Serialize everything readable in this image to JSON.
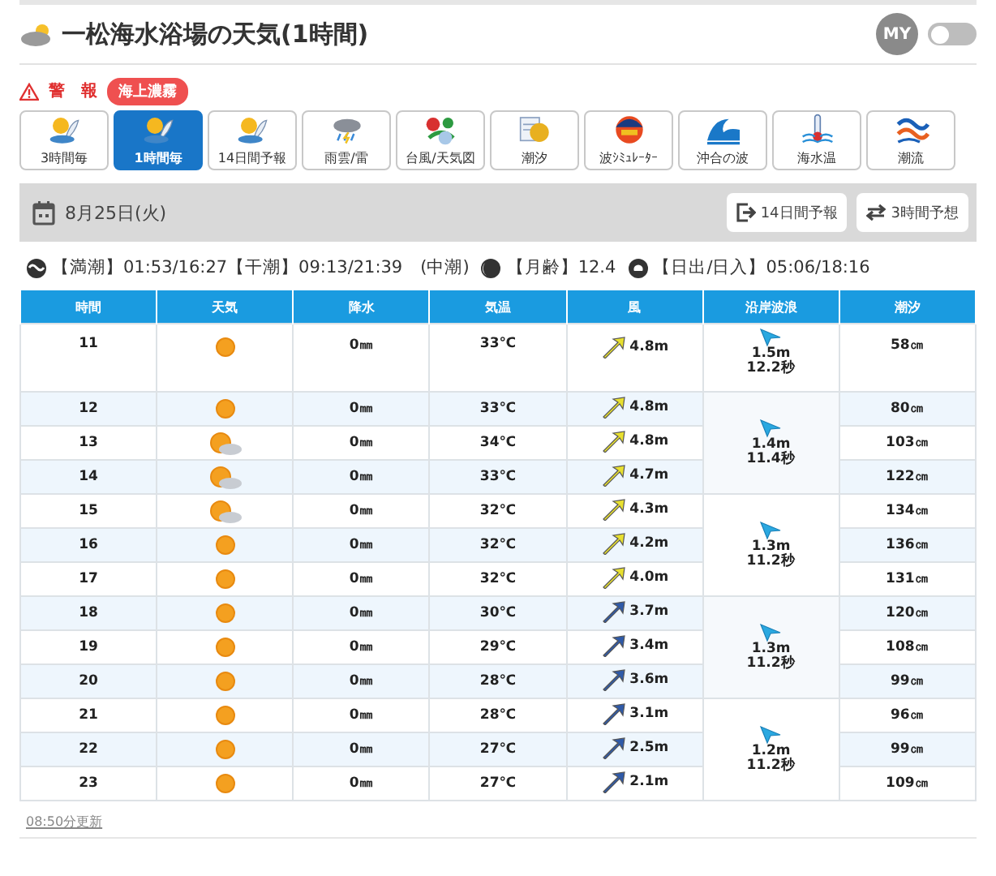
{
  "header": {
    "title": "一松海水浴場の天気(1時間)",
    "my_badge": "MY",
    "my_toggle_on": false
  },
  "warning": {
    "label": "警　報",
    "tags": [
      "海上濃霧"
    ]
  },
  "nav": [
    {
      "label": "3時間毎",
      "kind": "umbrella",
      "selected": false
    },
    {
      "label": "1時間毎",
      "kind": "umbrella",
      "selected": true
    },
    {
      "label": "14日間予報",
      "kind": "umbrella",
      "selected": false
    },
    {
      "label": "雨雲/雷",
      "kind": "rain",
      "selected": false
    },
    {
      "label": "台風/天気図",
      "kind": "map",
      "selected": false
    },
    {
      "label": "潮汐",
      "kind": "calendar",
      "selected": false
    },
    {
      "label": "波ｼﾐｭﾚｰﾀｰ",
      "kind": "face",
      "selected": false
    },
    {
      "label": "沖合の波",
      "kind": "wave",
      "selected": false
    },
    {
      "label": "海水温",
      "kind": "thermometer",
      "selected": false
    },
    {
      "label": "潮流",
      "kind": "current",
      "selected": false
    }
  ],
  "date_bar": {
    "date": "8月25日(火)",
    "buttons": [
      {
        "label": "14日間予報",
        "kind": "exit"
      },
      {
        "label": "3時間予想",
        "kind": "swap"
      }
    ]
  },
  "tide_info": [
    {
      "kind": "tide",
      "text": "【満潮】01:53/16:27【干潮】09:13/21:39　(中潮)"
    },
    {
      "kind": "moon",
      "text": "【月齢】12.4"
    },
    {
      "kind": "sunrise",
      "text": "【日出/日入】05:06/18:16"
    }
  ],
  "table": {
    "columns": [
      "時間",
      "天気",
      "降水",
      "気温",
      "風",
      "沿岸波浪",
      "潮汐"
    ],
    "groups": [
      {
        "wave": {
          "height": "1.5m",
          "period": "12.2秒"
        },
        "rows": [
          {
            "hour": "11",
            "kind": "sunny",
            "precip": "0㎜",
            "temp": "33℃",
            "wind": {
              "speed": "4.8m",
              "color": "#e8e030"
            },
            "tide": "58㎝"
          }
        ]
      },
      {
        "wave": {
          "height": "1.4m",
          "period": "11.4秒"
        },
        "rows": [
          {
            "hour": "12",
            "kind": "sunny",
            "precip": "0㎜",
            "temp": "33℃",
            "wind": {
              "speed": "4.8m",
              "color": "#e8e030"
            },
            "tide": "80㎝"
          },
          {
            "hour": "13",
            "kind": "partly_cloudy",
            "precip": "0㎜",
            "temp": "34℃",
            "wind": {
              "speed": "4.8m",
              "color": "#e8e030"
            },
            "tide": "103㎝"
          },
          {
            "hour": "14",
            "kind": "partly_cloudy",
            "precip": "0㎜",
            "temp": "33℃",
            "wind": {
              "speed": "4.7m",
              "color": "#e8e030"
            },
            "tide": "122㎝"
          }
        ]
      },
      {
        "wave": {
          "height": "1.3m",
          "period": "11.2秒"
        },
        "rows": [
          {
            "hour": "15",
            "kind": "partly_cloudy",
            "precip": "0㎜",
            "temp": "32℃",
            "wind": {
              "speed": "4.3m",
              "color": "#e8e030"
            },
            "tide": "134㎝"
          },
          {
            "hour": "16",
            "kind": "sunny",
            "precip": "0㎜",
            "temp": "32℃",
            "wind": {
              "speed": "4.2m",
              "color": "#e8e030"
            },
            "tide": "136㎝"
          },
          {
            "hour": "17",
            "kind": "sunny",
            "precip": "0㎜",
            "temp": "32℃",
            "wind": {
              "speed": "4.0m",
              "color": "#e8e030"
            },
            "tide": "131㎝"
          }
        ]
      },
      {
        "wave": {
          "height": "1.3m",
          "period": "11.2秒"
        },
        "rows": [
          {
            "hour": "18",
            "kind": "sunny",
            "precip": "0㎜",
            "temp": "30℃",
            "wind": {
              "speed": "3.7m",
              "color": "#2f5aa8"
            },
            "tide": "120㎝"
          },
          {
            "hour": "19",
            "kind": "sunny",
            "precip": "0㎜",
            "temp": "29℃",
            "wind": {
              "speed": "3.4m",
              "color": "#2f5aa8"
            },
            "tide": "108㎝"
          },
          {
            "hour": "20",
            "kind": "sunny",
            "precip": "0㎜",
            "temp": "28℃",
            "wind": {
              "speed": "3.6m",
              "color": "#2f5aa8"
            },
            "tide": "99㎝"
          }
        ]
      },
      {
        "wave": {
          "height": "1.2m",
          "period": "11.2秒"
        },
        "rows": [
          {
            "hour": "21",
            "kind": "sunny",
            "precip": "0㎜",
            "temp": "28℃",
            "wind": {
              "speed": "3.1m",
              "color": "#2f5aa8"
            },
            "tide": "96㎝"
          },
          {
            "hour": "22",
            "kind": "sunny",
            "precip": "0㎜",
            "temp": "27℃",
            "wind": {
              "speed": "2.5m",
              "color": "#2f5aa8"
            },
            "tide": "99㎝"
          },
          {
            "hour": "23",
            "kind": "sunny",
            "precip": "0㎜",
            "temp": "27℃",
            "wind": {
              "speed": "2.1m",
              "color": "#2f5aa8"
            },
            "tide": "109㎝"
          }
        ]
      }
    ]
  },
  "updated": "08:50分更新"
}
